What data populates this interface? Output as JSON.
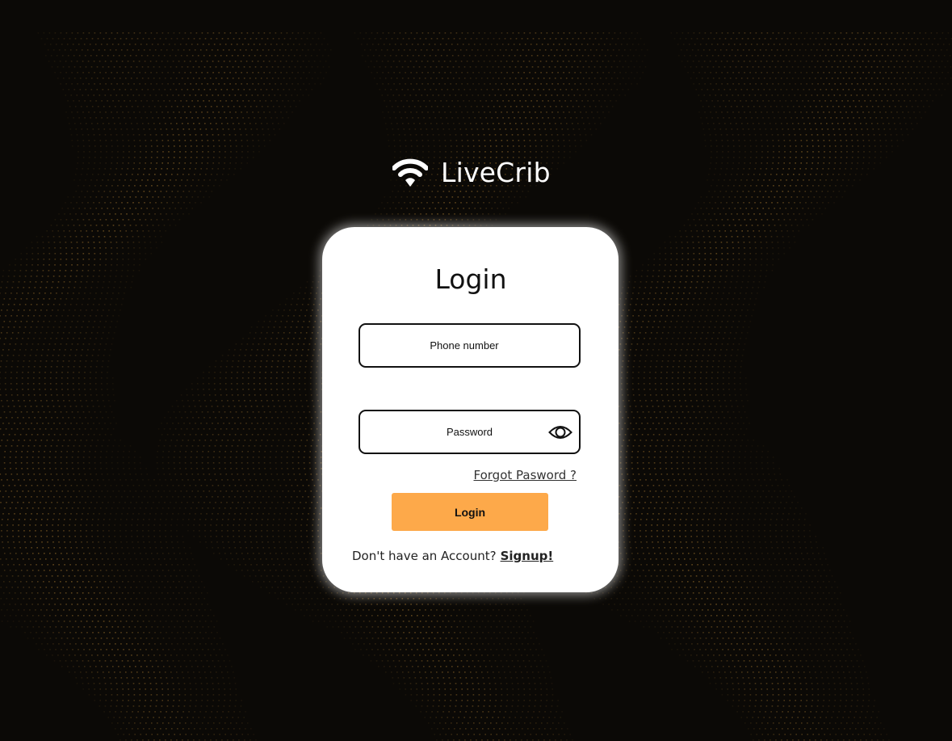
{
  "brand": {
    "name": "LiveCrib",
    "logo_icon": "wifi-icon"
  },
  "login": {
    "title": "Login",
    "phone_placeholder": "Phone number",
    "password_placeholder": "Password",
    "eye_icon": "eye-icon",
    "forgot_label": "Forgot Pasword ?",
    "button_label": "Login",
    "no_account_text": "Don't have an Account?",
    "signup_label": "Signup!"
  },
  "colors": {
    "background": "#0b0906",
    "accent": "#fda94a",
    "card": "#ffffff",
    "particles": "#c8913a"
  }
}
